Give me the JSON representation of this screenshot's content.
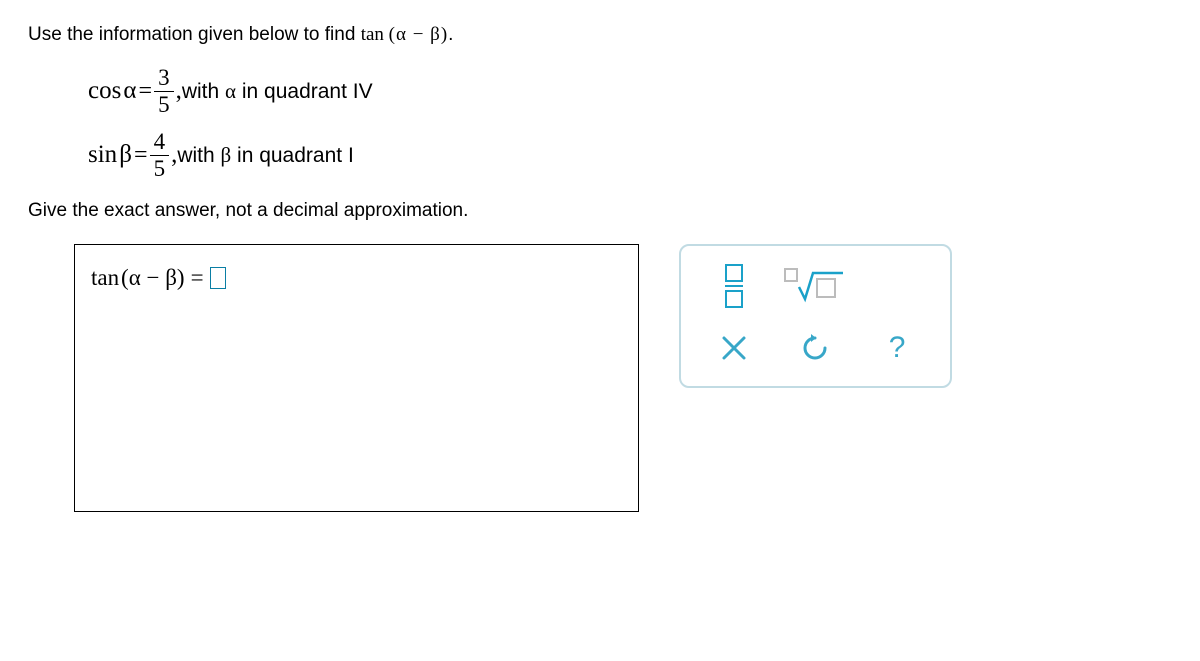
{
  "prompt": {
    "lead": "Use the information given below to find ",
    "target_fn": "tan",
    "target_arg": "(α − β)",
    "period": "."
  },
  "given": {
    "alpha": {
      "fn": "cos",
      "sym": "α",
      "num": "3",
      "den": "5",
      "comma": ",",
      "cond_with": " with ",
      "cond_var": "α",
      "cond_tail": " in quadrant IV"
    },
    "beta": {
      "fn": "sin",
      "sym": "β",
      "num": "4",
      "den": "5",
      "comma": ",",
      "cond_with": " with ",
      "cond_var": "β",
      "cond_tail": " in quadrant I"
    }
  },
  "instruction": "Give the exact answer, not a decimal approximation.",
  "answer": {
    "fn": "tan",
    "arg": "(α − β)",
    "eq": "=",
    "value": ""
  },
  "tools": {
    "fraction": "fraction-template",
    "sqrt": "nth-root-template",
    "clear": "clear",
    "undo": "undo",
    "help": "?"
  }
}
